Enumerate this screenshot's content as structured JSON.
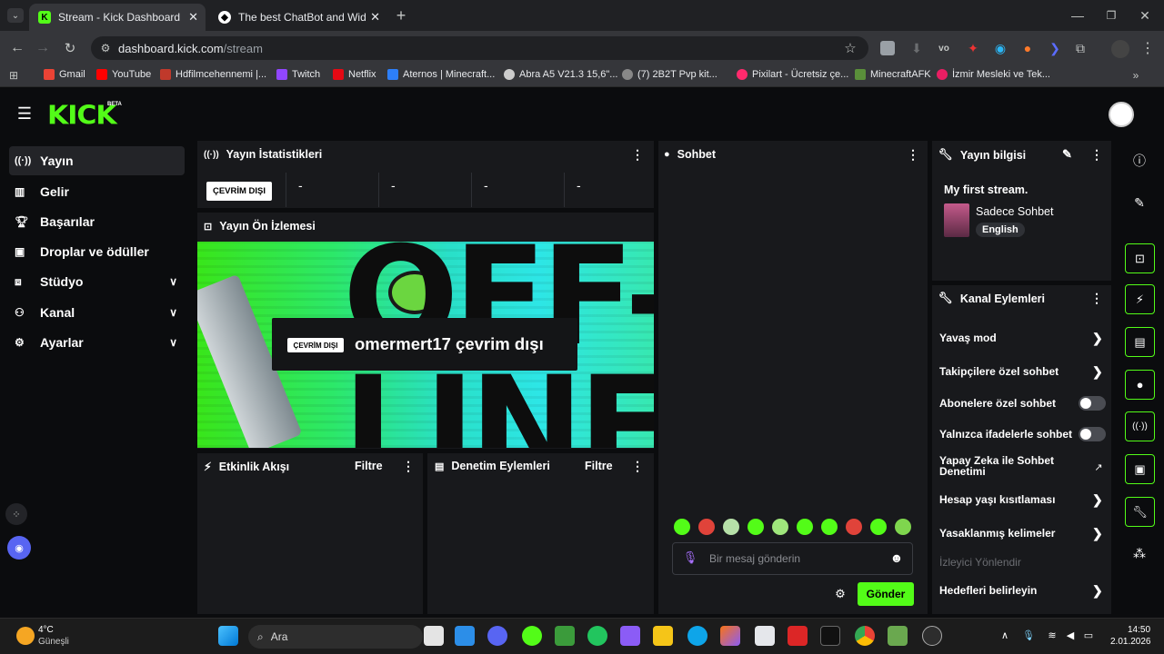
{
  "browser": {
    "tabs": [
      {
        "title": "Stream - Kick Dashboard"
      },
      {
        "title": "The best ChatBot and Widgets "
      }
    ],
    "url_domain": "dashboard.kick.com",
    "url_path": "/stream",
    "bookmarks": [
      "Gmail",
      "YouTube",
      "Hdfilmcehennemi |...",
      "Twitch",
      "Netflix",
      "Aternos | Minecraft...",
      "Abra A5 V21.3 15,6\"...",
      "(7) 2B2T Pvp kit...",
      "Pixilart - Ücretsiz çe...",
      "MinecraftAFK",
      "İzmir Mesleki ve Tek..."
    ]
  },
  "kick": {
    "logo": "KICK",
    "logo_badge": "BETA",
    "sidebar": [
      {
        "label": "Yayın",
        "icon": "broadcast-icon"
      },
      {
        "label": "Gelir",
        "icon": "chart-icon"
      },
      {
        "label": "Başarılar",
        "icon": "trophy-icon"
      },
      {
        "label": "Droplar ve ödüller",
        "icon": "gift-icon"
      },
      {
        "label": "Stüdyo",
        "icon": "studio-icon"
      },
      {
        "label": "Kanal",
        "icon": "user-icon"
      },
      {
        "label": "Ayarlar",
        "icon": "gear-icon"
      }
    ],
    "stats": {
      "title": "Yayın İstatistikleri",
      "status": "ÇEVRİM DIŞI",
      "values": [
        "-",
        "-",
        "-",
        "-"
      ]
    },
    "preview": {
      "title": "Yayın Ön İzlemesi",
      "status": "ÇEVRİM DIŞI",
      "message": "omermert17 çevrim dışı",
      "bg_text": "OFF-LINE"
    },
    "activity": {
      "title": "Etkinlik Akışı",
      "filter": "Filtre"
    },
    "moderation": {
      "title": "Denetim Eylemleri",
      "filter": "Filtre"
    },
    "chat": {
      "title": "Sohbet",
      "placeholder": "Bir mesaj gönderin",
      "send": "Gönder"
    },
    "stream_info": {
      "title": "Yayın bilgisi",
      "stream_title": "My first stream.",
      "category": "Sadece Sohbet",
      "language": "English"
    },
    "channel_actions": {
      "title": "Kanal Eylemleri",
      "items": [
        "Yavaş mod",
        "Takipçilere özel sohbet",
        "Abonelere özel sohbet",
        "Yalnızca ifadelerle sohbet",
        "Yapay Zeka ile Sohbet Denetimi",
        "Hesap yaşı kısıtlaması",
        "Yasaklanmış kelimeler",
        "İzleyici Yönlendir",
        "Hedefleri belirleyin"
      ]
    }
  },
  "taskbar": {
    "weather_temp": "4°C",
    "weather_desc": "Güneşli",
    "search": "Ara",
    "time": "14:50",
    "date": "2.01.2026"
  },
  "colors": {
    "accent": "#53fc18",
    "panel": "#18191c",
    "bg": "#0b0c0e"
  }
}
